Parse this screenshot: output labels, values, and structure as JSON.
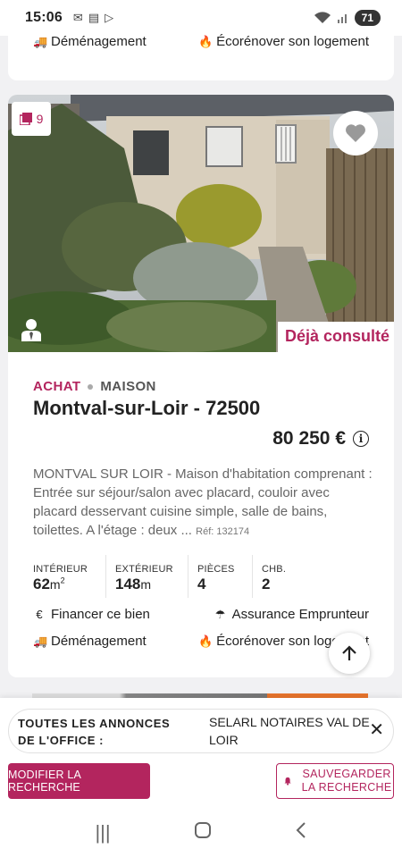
{
  "status": {
    "time": "15:06",
    "battery": "71"
  },
  "prev_card": {
    "service_left": "Déménagement",
    "service_right": "Écorénover son logement"
  },
  "listing": {
    "photo_count": "9",
    "seen_label": "Déjà consulté",
    "transaction": "ACHAT",
    "property_type": "MAISON",
    "title": "Montval-sur-Loir - 72500",
    "price": "80 250 €",
    "description": "MONTVAL SUR LOIR - Maison d'habitation comprenant : Entrée sur séjour/salon avec placard, couloir avec placard desservant cuisine simple, salle de bains, toilettes. A l'étage : deux ...",
    "ref": "Réf: 132174",
    "specs": {
      "interior_label": "INTÉRIEUR",
      "interior_value": "62",
      "interior_unit": "m",
      "interior_sup": "2",
      "exterior_label": "EXTÉRIEUR",
      "exterior_value": "148",
      "exterior_unit": "m",
      "rooms_label": "PIÈCES",
      "rooms_value": "4",
      "bedrooms_label": "CHB.",
      "bedrooms_value": "2"
    },
    "services": {
      "finance": "Financer ce bien",
      "insurance": "Assurance Emprunteur",
      "moving": "Déménagement",
      "renovate": "Écorénover son logement"
    }
  },
  "panel": {
    "office_label": "TOUTES LES ANNONCES DE L'OFFICE :",
    "office_name": "SELARL NOTAIRES VAL DE LOIR",
    "modify_button": "MODIFIER LA RECHERCHE",
    "save_button": "SAUVEGARDER LA RECHERCHE"
  },
  "colors": {
    "accent": "#b3255e"
  },
  "icons": [
    "truck-icon",
    "flame-icon",
    "gallery-icon",
    "heart-icon",
    "agent-icon",
    "info-icon",
    "euro-icon",
    "umbrella-icon",
    "arrow-up-icon",
    "close-icon",
    "bell-icon"
  ]
}
